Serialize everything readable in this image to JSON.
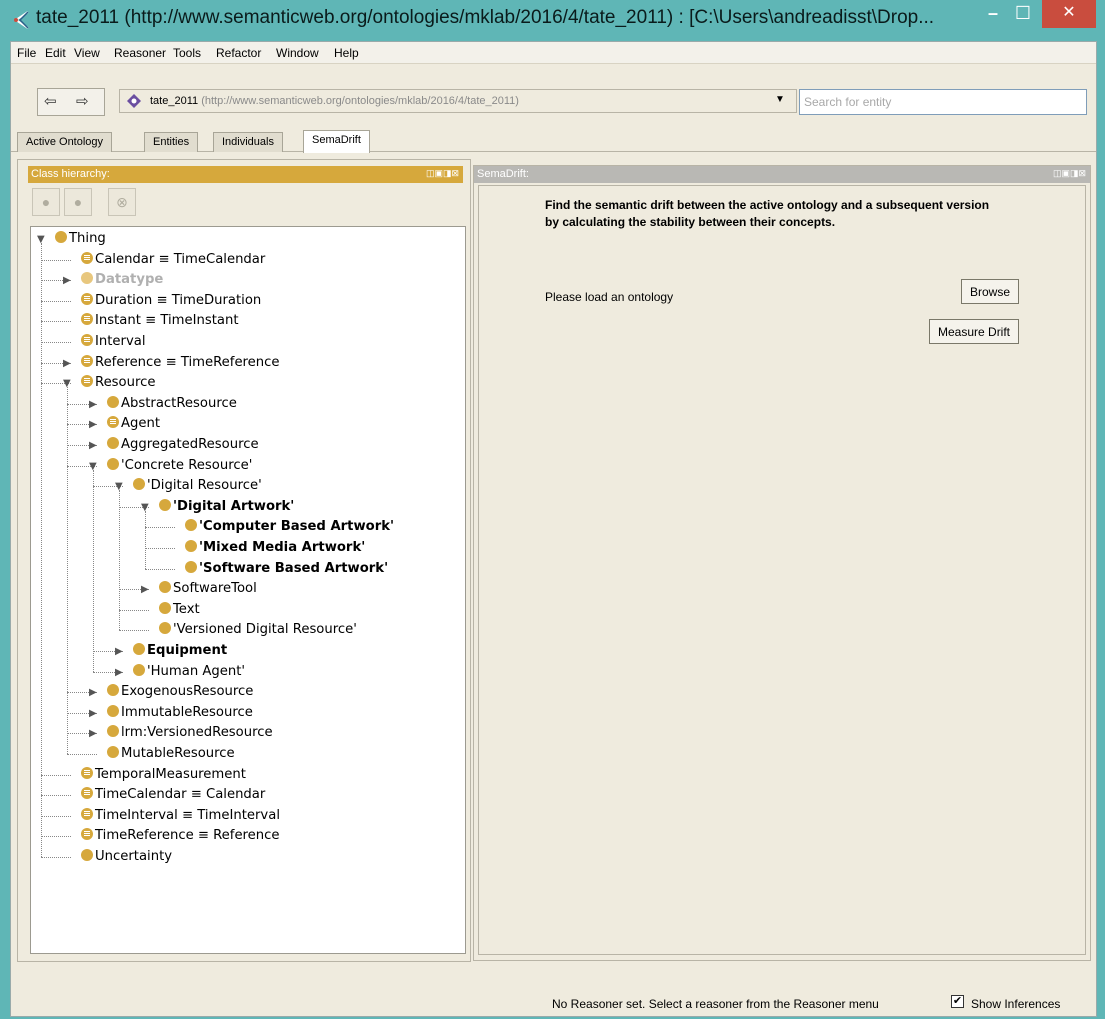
{
  "window": {
    "title": "tate_2011 (http://www.semanticweb.org/ontologies/mklab/2016/4/tate_2011)  : [C:\\Users\\andreadisst\\Drop...",
    "minimize_label": "–",
    "maximize_label": "☐",
    "close_label": "✕"
  },
  "menu": [
    "File",
    "Edit",
    "View",
    "Reasoner",
    "Tools",
    "Refactor",
    "Window",
    "Help"
  ],
  "nav": {
    "back_label": "⇦",
    "forward_label": "⇨",
    "ontology_name": "tate_2011",
    "ontology_iri": "(http://www.semanticweb.org/ontologies/mklab/2016/4/tate_2011)",
    "dropdown_arrow": "▼",
    "search_placeholder": "Search for entity"
  },
  "tabs": [
    "Active Ontology",
    "Entities",
    "Individuals",
    "SemaDrift"
  ],
  "active_tab": "SemaDrift",
  "left_panel": {
    "title": "Class hierarchy:",
    "controls": "◫▣◨⊠"
  },
  "tree": [
    {
      "label": "Thing",
      "depth": 0,
      "toggle": "▼",
      "eq": false
    },
    {
      "label": "Calendar ≡ TimeCalendar",
      "depth": 1,
      "toggle": "",
      "eq": true
    },
    {
      "label": "Datatype",
      "depth": 1,
      "toggle": "▶",
      "eq": false,
      "dim": true
    },
    {
      "label": "Duration ≡ TimeDuration",
      "depth": 1,
      "toggle": "",
      "eq": true
    },
    {
      "label": "Instant ≡ TimeInstant",
      "depth": 1,
      "toggle": "",
      "eq": true
    },
    {
      "label": "Interval",
      "depth": 1,
      "toggle": "",
      "eq": true
    },
    {
      "label": "Reference ≡ TimeReference",
      "depth": 1,
      "toggle": "▶",
      "eq": true
    },
    {
      "label": "Resource",
      "depth": 1,
      "toggle": "▼",
      "eq": true
    },
    {
      "label": "AbstractResource",
      "depth": 2,
      "toggle": "▶",
      "eq": false
    },
    {
      "label": "Agent",
      "depth": 2,
      "toggle": "▶",
      "eq": true
    },
    {
      "label": "AggregatedResource",
      "depth": 2,
      "toggle": "▶",
      "eq": false
    },
    {
      "label": "'Concrete Resource'",
      "depth": 2,
      "toggle": "▼",
      "eq": false
    },
    {
      "label": "'Digital Resource'",
      "depth": 3,
      "toggle": "▼",
      "eq": false
    },
    {
      "label": "'Digital Artwork'",
      "depth": 4,
      "toggle": "▼",
      "eq": false,
      "bold": true
    },
    {
      "label": "'Computer Based Artwork'",
      "depth": 5,
      "toggle": "",
      "eq": false,
      "bold": true
    },
    {
      "label": "'Mixed Media Artwork'",
      "depth": 5,
      "toggle": "",
      "eq": false,
      "bold": true
    },
    {
      "label": "'Software Based Artwork'",
      "depth": 5,
      "toggle": "",
      "eq": false,
      "bold": true
    },
    {
      "label": "SoftwareTool",
      "depth": 4,
      "toggle": "▶",
      "eq": false
    },
    {
      "label": "Text",
      "depth": 4,
      "toggle": "",
      "eq": false
    },
    {
      "label": "'Versioned Digital Resource'",
      "depth": 4,
      "toggle": "",
      "eq": false
    },
    {
      "label": "Equipment",
      "depth": 3,
      "toggle": "▶",
      "eq": false,
      "bold": true
    },
    {
      "label": "'Human Agent'",
      "depth": 3,
      "toggle": "▶",
      "eq": false
    },
    {
      "label": "ExogenousResource",
      "depth": 2,
      "toggle": "▶",
      "eq": false
    },
    {
      "label": "ImmutableResource",
      "depth": 2,
      "toggle": "▶",
      "eq": false
    },
    {
      "label": "lrm:VersionedResource",
      "depth": 2,
      "toggle": "▶",
      "eq": false
    },
    {
      "label": "MutableResource",
      "depth": 2,
      "toggle": "",
      "eq": false
    },
    {
      "label": "TemporalMeasurement",
      "depth": 1,
      "toggle": "",
      "eq": true
    },
    {
      "label": "TimeCalendar ≡ Calendar",
      "depth": 1,
      "toggle": "",
      "eq": true
    },
    {
      "label": "TimeInterval ≡ TimeInterval",
      "depth": 1,
      "toggle": "",
      "eq": true
    },
    {
      "label": "TimeReference ≡ Reference",
      "depth": 1,
      "toggle": "",
      "eq": true
    },
    {
      "label": "Uncertainty",
      "depth": 1,
      "toggle": "",
      "eq": false
    }
  ],
  "right_panel": {
    "title": "SemaDrift:",
    "controls": "◫▣◨⊠",
    "description": "Find the semantic drift between the active ontology and a subsequent version by calculating the stability between their concepts.",
    "status": "Please load an ontology",
    "browse_label": "Browse",
    "measure_label": "Measure Drift"
  },
  "statusbar": {
    "message": "No Reasoner set. Select a reasoner from the Reasoner menu",
    "check_mark": "✔",
    "show_inferences_label": "Show Inferences",
    "show_inferences_checked": true
  },
  "colors": {
    "class_dot": "#d6a83c",
    "panel_header": "#d6a83c",
    "title_bar": "#5fb6b6",
    "close_button": "#c94d3e"
  }
}
